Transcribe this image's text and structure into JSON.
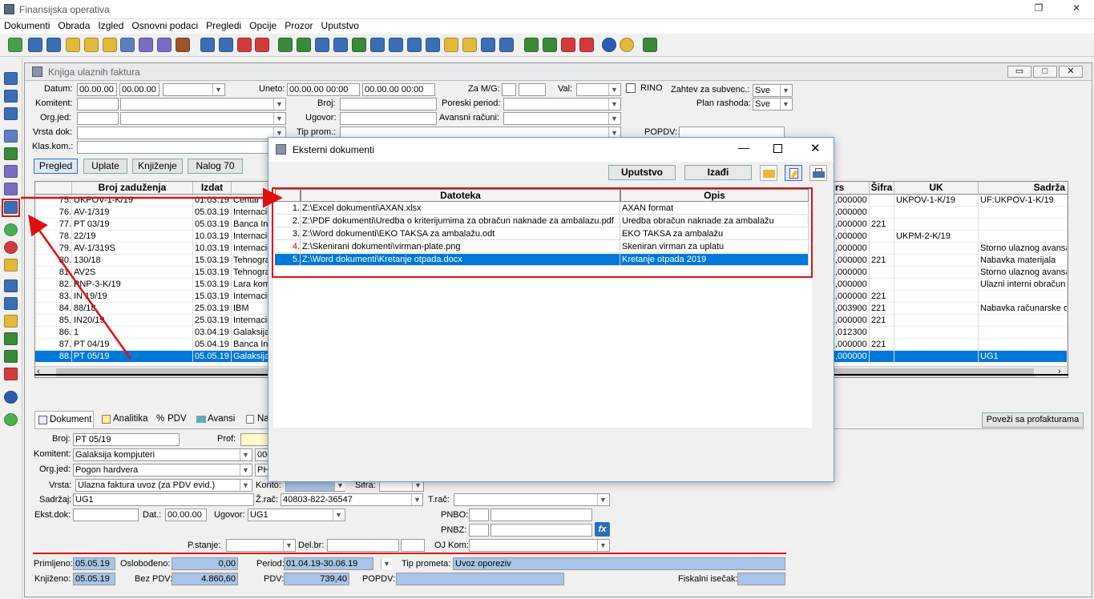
{
  "app": {
    "title": "Finansijska operativa"
  },
  "menu": [
    "Dokumenti",
    "Obrada",
    "Izgled",
    "Osnovni podaci",
    "Pregledi",
    "Opcije",
    "Prozor",
    "Uputstvo"
  ],
  "window": {
    "title": "Knjiga ulaznih faktura"
  },
  "filters": {
    "datum_label": "Datum:",
    "datum_from": "00.00.00",
    "datum_to": "00.00.00",
    "uneto_label": "Uneto:",
    "uneto_from": "00.00.00 00:00",
    "uneto_to": "00.00.00 00:00",
    "zamg_label": "Za M/G:",
    "val_label": "Val:",
    "rino_label": "RINO",
    "zahtev_label": "Zahtev za subvenc.:",
    "zahtev_value": "Sve",
    "plan_label": "Plan rashoda:",
    "plan_value": "Sve",
    "komitent_label": "Komitent:",
    "broj_label": "Broj:",
    "poreski_label": "Poreski period:",
    "orgjed_label": "Org.jed:",
    "ugovor_label": "Ugovor:",
    "avansni_label": "Avansni računi:",
    "vrstadok_label": "Vrsta dok:",
    "tipprom_label": "Tip prom.:",
    "popdv_label": "POPDV:",
    "klaskom_label": "Klas.kom.:"
  },
  "view_buttons": [
    "Pregled",
    "Uplate",
    "Knjiženje",
    "Nalog 70"
  ],
  "grid": {
    "headers": {
      "broj": "Broj zaduženja",
      "izdat": "Izdat",
      "rs": "rs",
      "sifra": "Šifra",
      "uk": "UK",
      "sadrzaj": "Sadrža"
    },
    "rows": [
      {
        "n": "75.",
        "broj": "UKPOV-1-K/19",
        "izdat": "01.03.19",
        "kom": "Centar tr",
        "rs": ",000000",
        "sifra": "",
        "uk": "UKPOV-1-K/19",
        "sad": "UF:UKPOV-1-K/19"
      },
      {
        "n": "76.",
        "broj": "AV-1/319",
        "izdat": "05.03.19",
        "kom": "Internacio",
        "rs": ",000000",
        "sifra": "",
        "uk": "",
        "sad": ""
      },
      {
        "n": "77.",
        "broj": "PT 03/19",
        "izdat": "05.03.19",
        "kom": "Banca Int",
        "rs": ",000000",
        "sifra": "221",
        "uk": "",
        "sad": ""
      },
      {
        "n": "78.",
        "broj": "22/19",
        "izdat": "10.03.19",
        "kom": "Internacio",
        "rs": ",000000",
        "sifra": "",
        "uk": "UKPM-2-K/19",
        "sad": ""
      },
      {
        "n": "79.",
        "broj": "AV-1/319S",
        "izdat": "10.03.19",
        "kom": "Internacio",
        "rs": ",000000",
        "sifra": "",
        "uk": "",
        "sad": "Storno ulaznog avansa"
      },
      {
        "n": "80.",
        "broj": "130/18",
        "izdat": "15.03.19",
        "kom": "Tehnogra",
        "rs": ",000000",
        "sifra": "221",
        "uk": "",
        "sad": "Nabavka materijala"
      },
      {
        "n": "81.",
        "broj": "AV2S",
        "izdat": "15.03.19",
        "kom": "Tehnogra",
        "rs": ",000000",
        "sifra": "",
        "uk": "",
        "sad": "Storno ulaznog avansa"
      },
      {
        "n": "82.",
        "broj": "PNP-3-K/19",
        "izdat": "15.03.19",
        "kom": "Lara kome",
        "rs": ",000000",
        "sifra": "",
        "uk": "",
        "sad": "Ulazni interni obračun P"
      },
      {
        "n": "83.",
        "broj": "IN 19/19",
        "izdat": "15.03.19",
        "kom": "Internacio",
        "rs": ",000000",
        "sifra": "221",
        "uk": "",
        "sad": ""
      },
      {
        "n": "84.",
        "broj": "88/18",
        "izdat": "25.03.19",
        "kom": "IBM",
        "rs": ",003900",
        "sifra": "221",
        "uk": "",
        "sad": "Nabavka računarske op"
      },
      {
        "n": "85.",
        "broj": "IN20/19",
        "izdat": "25.03.19",
        "kom": "Internacio",
        "rs": ",000000",
        "sifra": "221",
        "uk": "",
        "sad": ""
      },
      {
        "n": "86.",
        "broj": "1",
        "izdat": "03.04.19",
        "kom": "Galaksija",
        "rs": ",012300",
        "sifra": "",
        "uk": "",
        "sad": ""
      },
      {
        "n": "87.",
        "broj": "PT 04/19",
        "izdat": "05.04.19",
        "kom": "Banca Int",
        "rs": ",000000",
        "sifra": "221",
        "uk": "",
        "sad": ""
      },
      {
        "n": "88.",
        "broj": "PT 05/19",
        "izdat": "05.05.19",
        "kom": "Galaksija",
        "rs": ",000000",
        "sifra": "",
        "uk": "",
        "sad": "UG1"
      }
    ]
  },
  "tabs": [
    "Dokument",
    "Analitika",
    "PDV",
    "Avansi",
    "Na"
  ],
  "povezi_button": "Poveži sa profakturama",
  "detail": {
    "broj_label": "Broj:",
    "broj_value": "PT 05/19",
    "prof_label": "Prof:",
    "komitent_label": "Komitent:",
    "komitent_value": "Galaksija kompjuteri",
    "komitent_code": "000",
    "orgjed_label": "Org.jed:",
    "orgjed_value": "Pogon hardvera",
    "orgjed_code": "PH",
    "vrsta_label": "Vrsta:",
    "vrsta_value": "Ulazna faktura uvoz (za PDV evid.)",
    "konto_label": "Konto:",
    "sifra_label": "Šifra:",
    "sadrzaj_label": "Sadržaj:",
    "sadrzaj_value": "UG1",
    "zrac_label": "Ž.rač:",
    "zrac_value": "40803-822-36547",
    "trac_label": "T.rač:",
    "ekst_label": "Ekst.dok:",
    "dat_label": "Dat.:",
    "dat_value": "00.00.00",
    "ugovor_label": "Ugovor:",
    "ugovor_value": "UG1",
    "pnbo_label": "PNBO:",
    "pnbz_label": "PNBZ:",
    "fx_label": "fx",
    "pstanje_label": "P.stanje:",
    "delbr_label": "Del.br:",
    "ojkom_label": "OJ Kom:",
    "primljeno_label": "Primljeno:",
    "primljeno_value": "05.05.19",
    "oslobodjeno_label": "Oslobođeno:",
    "oslobodjeno_value": "0,00",
    "period_label": "Period:",
    "period_value": "01.04.19-30.06.19",
    "tipprometa_label": "Tip prometa:",
    "tipprometa_value": "Uvoz oporeziv",
    "knjizeno_label": "Knjiženo:",
    "knjizeno_value": "05.05.19",
    "bezpdv_label": "Bez PDV:",
    "bezpdv_value": "4.860,60",
    "pdv_label": "PDV:",
    "pdv_value": "739,40",
    "popdv_label": "POPDV:",
    "fiskalni_label": "Fiskalni isečak:"
  },
  "dialog": {
    "title": "Eksterni dokumenti",
    "uputstvo": "Uputstvo",
    "izadji": "Izađi",
    "headers": {
      "datoteka": "Datoteka",
      "opis": "Opis"
    },
    "rows": [
      {
        "n": "1.",
        "datoteka": "Z:\\Excel dokumenti\\AXAN.xlsx",
        "opis": "AXAN format"
      },
      {
        "n": "2.",
        "datoteka": "Z:\\PDF dokumenti\\Uredba o kriterijumima za obračun naknade za ambalazu.pdf",
        "opis": "Uredba obračun naknade za ambalažu"
      },
      {
        "n": "3.",
        "datoteka": "Z:\\Word dokumenti\\EKO TAKSA za ambalažu.odt",
        "opis": "EKO TAKSA za ambalažu"
      },
      {
        "n": "4.",
        "datoteka": "Z:\\Skenirani dokumenti\\virman-plate.png",
        "opis": "Skeniran virman za uplatu"
      },
      {
        "n": "5.",
        "datoteka": "Z:\\Word dokumenti\\Kretanje otpada.docx",
        "opis": "Kretanje otpada 2019"
      }
    ]
  },
  "colors": {
    "accent": "#0078d7",
    "annotation": "#e01010"
  }
}
